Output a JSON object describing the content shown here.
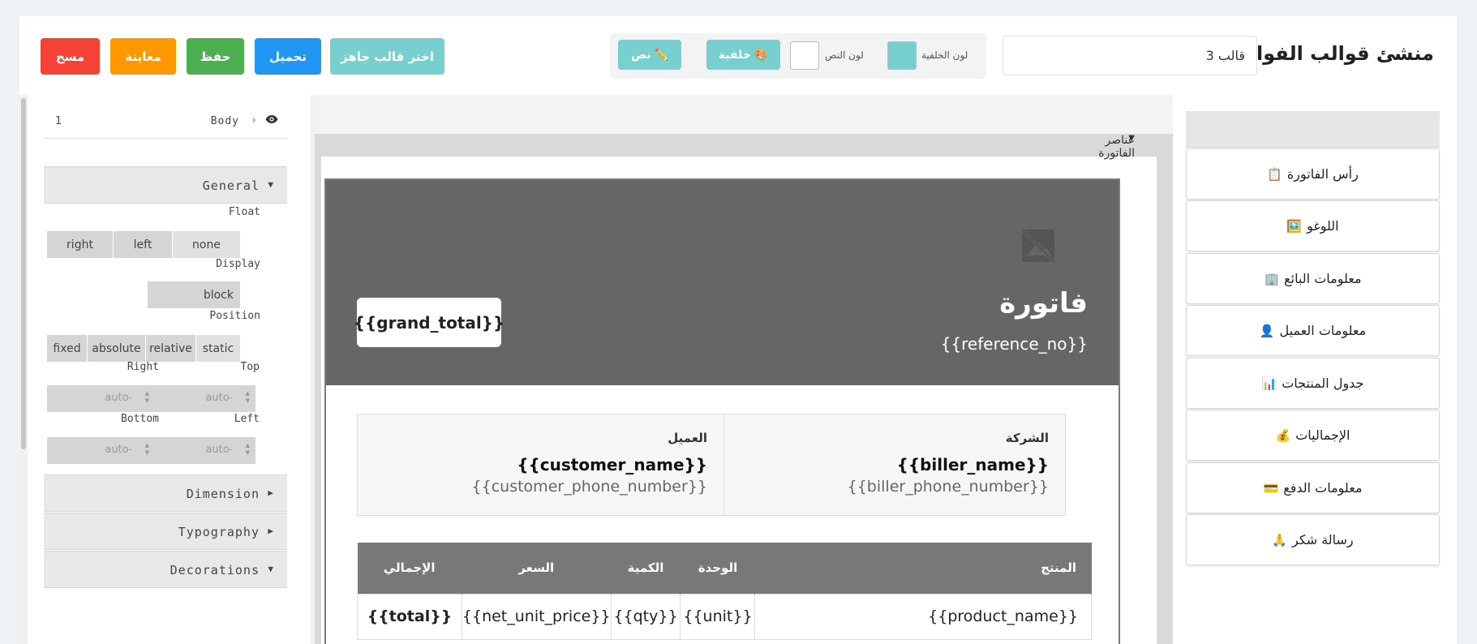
{
  "app": {
    "title": "منشئ قوالب الفواتير",
    "template_name": "قالب 3"
  },
  "colors": {
    "bg_color_label": "لون الخلفية",
    "bg_color": "#77cfcf",
    "text_color_label": "لون النص",
    "text_color": "#ffffff",
    "mode_background": "خلفية",
    "mode_text": "نص"
  },
  "toolbar": {
    "pick_template": "اختر قالب جاهز",
    "load": "تحميل",
    "save": "حفظ",
    "preview": "معاينة",
    "clear": "مسح"
  },
  "style_manager": {
    "breadcrumb_value": "1",
    "breadcrumb_body": "Body",
    "general": "General",
    "float_label": "Float",
    "float_options": [
      "right",
      "left",
      "none"
    ],
    "display_label": "Display",
    "display_value": "block",
    "position_label": "Position",
    "position_options": [
      "fixed",
      "absolute",
      "relative",
      "static"
    ],
    "top_label": "Top",
    "right_label": "Right",
    "left_label": "Left",
    "bottom_label": "Bottom",
    "auto": "auto",
    "dimension": "Dimension",
    "typography": "Typography",
    "decorations": "Decorations"
  },
  "invoice": {
    "title": "فاتورة",
    "reference": "{{reference_no}}",
    "grand_total": "{{grand_total}}",
    "company_label": "الشركة",
    "biller_name": "{{biller_name}}",
    "biller_phone": "{{biller_phone_number}}",
    "customer_label": "العميل",
    "customer_name": "{{customer_name}}",
    "customer_phone": "{{customer_phone_number}}",
    "table": {
      "headers": [
        "المنتج",
        "الوحدة",
        "الكمية",
        "السعر",
        "الإجمالي"
      ],
      "row": [
        "{{product_name}}",
        "{{unit}}",
        "{{qty}}",
        "{{net_unit_price}}",
        "{{total}}"
      ]
    }
  },
  "blocks": {
    "header": "عناصر الفاتورة",
    "items": [
      {
        "label": "رأس الفاتورة",
        "icon": "📋"
      },
      {
        "label": "اللوغو",
        "icon": "🖼️"
      },
      {
        "label": "معلومات البائع",
        "icon": "🏢"
      },
      {
        "label": "معلومات العميل",
        "icon": "👤"
      },
      {
        "label": "جدول المنتجات",
        "icon": "📊"
      },
      {
        "label": "الإجماليات",
        "icon": "💰"
      },
      {
        "label": "معلومات الدفع",
        "icon": "💳"
      },
      {
        "label": "رسالة شكر",
        "icon": "🙏"
      }
    ]
  }
}
